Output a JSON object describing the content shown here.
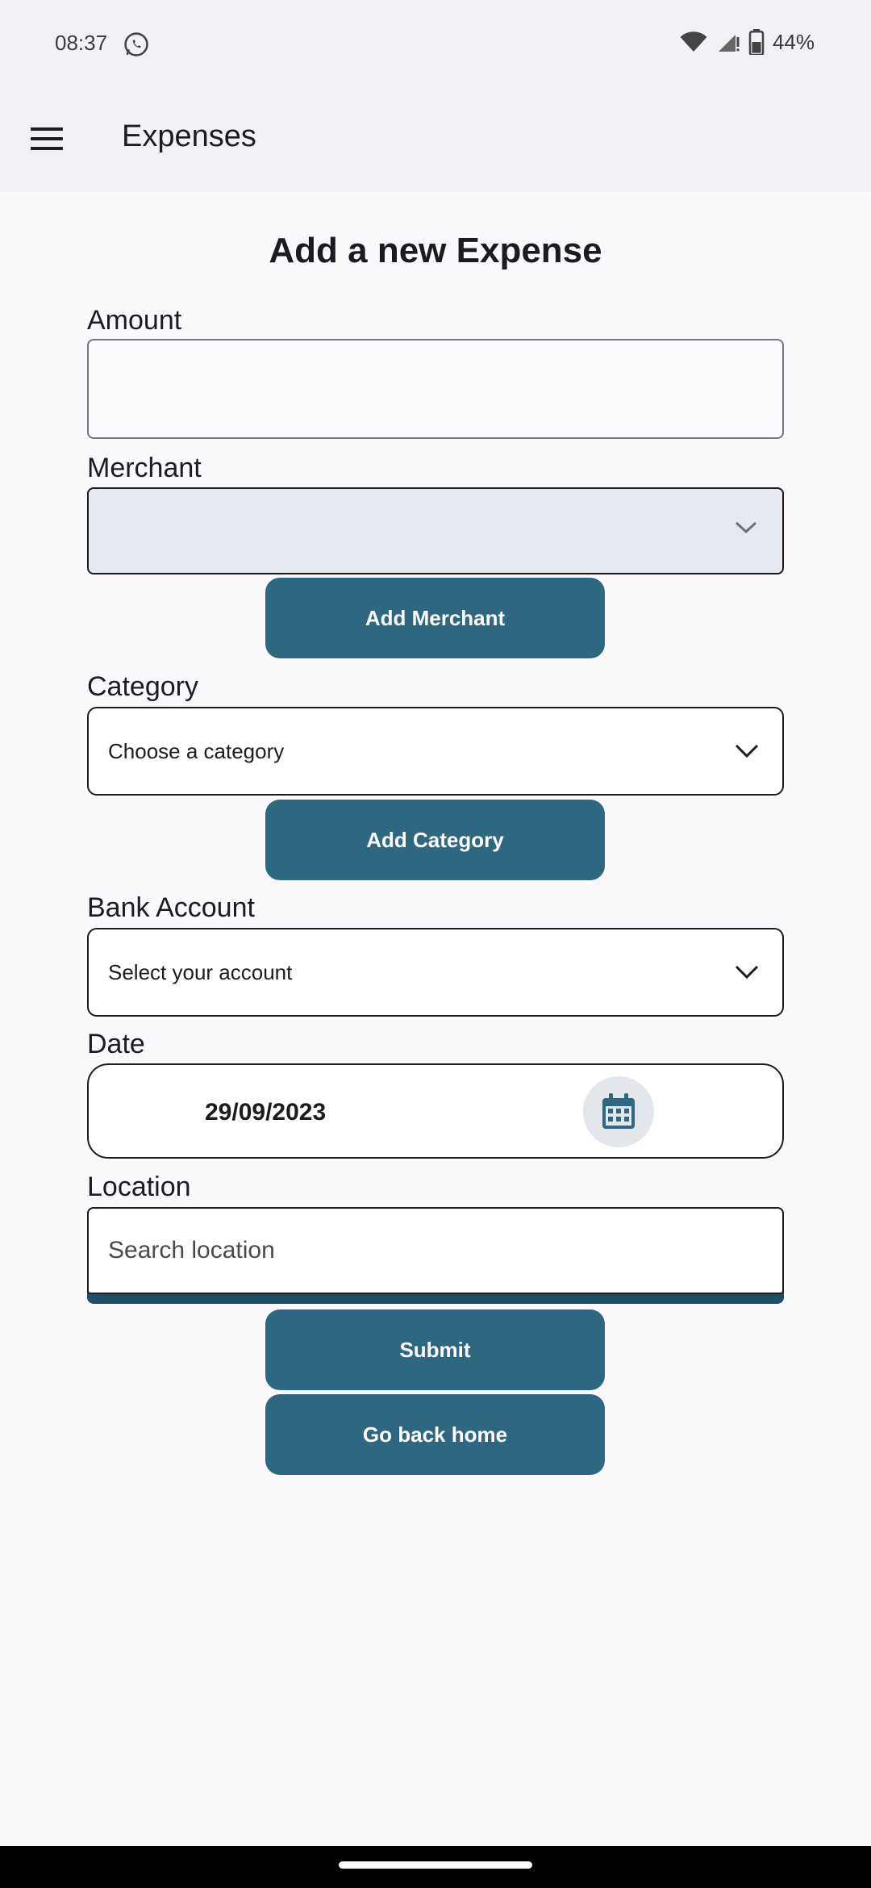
{
  "status_bar": {
    "time": "08:37",
    "battery": "44%",
    "icons": [
      "whatsapp-icon",
      "wifi-icon",
      "signal-icon",
      "battery-icon"
    ]
  },
  "app_bar": {
    "menu_icon": "hamburger-menu-icon",
    "title": "Expenses"
  },
  "form": {
    "title": "Add a new Expense",
    "amount": {
      "label": "Amount",
      "value": ""
    },
    "merchant": {
      "label": "Merchant",
      "value": ""
    },
    "add_merchant_label": "Add Merchant",
    "category": {
      "label": "Category",
      "value": "Choose a category"
    },
    "add_category_label": "Add Category",
    "bank_account": {
      "label": "Bank Account",
      "value": "Select your account"
    },
    "date": {
      "label": "Date",
      "value": "29/09/2023"
    },
    "location": {
      "label": "Location",
      "placeholder": "Search location"
    },
    "submit_label": "Submit",
    "home_label": "Go back home"
  },
  "colors": {
    "primary": "#2e6782",
    "background": "#fcf9fd",
    "appbar": "#f3f1f6"
  }
}
